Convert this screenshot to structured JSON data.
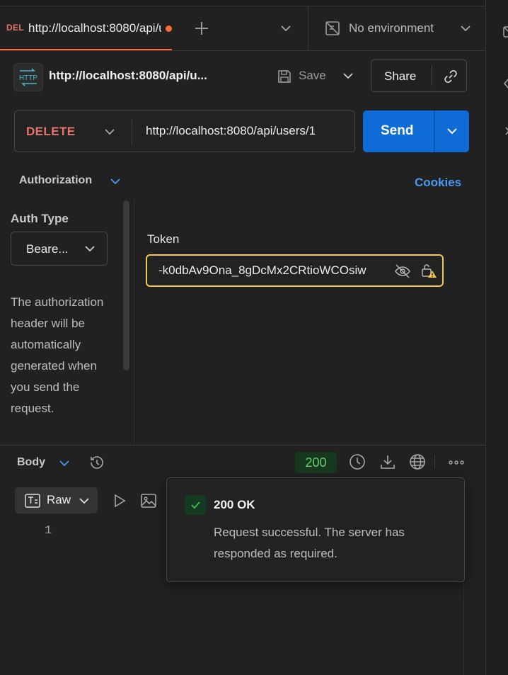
{
  "tab": {
    "method": "DEL",
    "url": "http://localhost:8080/api/users/1",
    "unsaved": true
  },
  "environment": {
    "label": "No environment"
  },
  "request": {
    "icon_label": "HTTP",
    "name": "http://localhost:8080/api/u...",
    "save_label": "Save",
    "share_label": "Share",
    "method": "DELETE",
    "url": "http://localhost:8080/api/users/1",
    "send_label": "Send"
  },
  "auth": {
    "tab_label": "Authorization",
    "cookies_label": "Cookies",
    "type_label": "Auth Type",
    "type_value": "Beare...",
    "description": "The authorization header will be automatically generated when you send the request.",
    "token_label": "Token",
    "token_value": "-k0dbAv9Ona_8gDcMx2CRtioWCOsiw"
  },
  "response": {
    "body_label": "Body",
    "status_code": "200",
    "raw_label": "Raw",
    "line_number": "1",
    "status_popup": {
      "title": "200 OK",
      "description": "Request successful. The server has responded as required."
    }
  },
  "colors": {
    "accent": "#ff6c37",
    "send": "#0f6bd6",
    "method_delete": "#e4766b",
    "link": "#4a9af2",
    "token_focus": "#f2c94c",
    "status_ok": "#62d06e"
  },
  "icons": [
    "plus-icon",
    "chevron-down-icon",
    "no-environment-icon",
    "http-icon",
    "save-icon",
    "link-icon",
    "eye-off-icon",
    "lock-warning-icon",
    "history-icon",
    "clock-icon",
    "download-icon",
    "globe-icon",
    "more-icon",
    "text-icon",
    "play-icon",
    "image-icon",
    "check-icon"
  ]
}
